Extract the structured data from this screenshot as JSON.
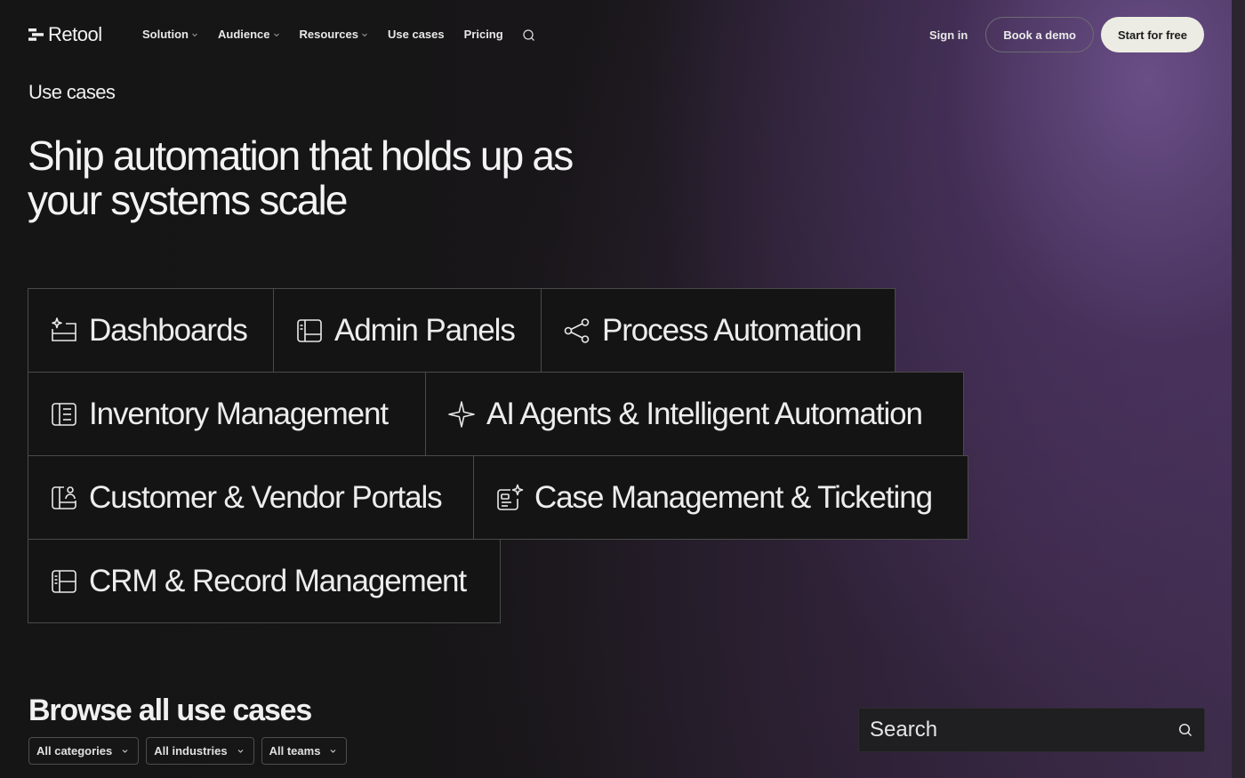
{
  "nav": {
    "logo_text": "Retool",
    "links": [
      {
        "label": "Solution",
        "dropdown": true
      },
      {
        "label": "Audience",
        "dropdown": true
      },
      {
        "label": "Resources",
        "dropdown": true
      },
      {
        "label": "Use cases",
        "dropdown": false
      },
      {
        "label": "Pricing",
        "dropdown": false
      }
    ],
    "sign_in": "Sign in",
    "book_demo": "Book a demo",
    "start_free": "Start for free"
  },
  "hero": {
    "eyebrow": "Use cases",
    "title": "Ship automation that holds up as your systems scale"
  },
  "categories": [
    {
      "label": "Dashboards",
      "icon": "dashboard-sparkle-icon"
    },
    {
      "label": "Admin Panels",
      "icon": "panel-layout-icon"
    },
    {
      "label": "Process Automation",
      "icon": "share-nodes-icon"
    },
    {
      "label": "Inventory Management",
      "icon": "list-panel-icon"
    },
    {
      "label": "AI Agents & Intelligent Automation",
      "icon": "sparkle-icon"
    },
    {
      "label": "Customer & Vendor Portals",
      "icon": "portal-user-icon"
    },
    {
      "label": "Case Management & Ticketing",
      "icon": "ticket-sparkle-icon"
    },
    {
      "label": "CRM & Record Management",
      "icon": "record-panel-icon"
    }
  ],
  "browse": {
    "title": "Browse all use cases",
    "filters": [
      "All categories",
      "All industries",
      "All teams"
    ],
    "search_placeholder": "Search"
  },
  "colors": {
    "background": "#151515",
    "accent_gradient": "#6c508a",
    "tile_border": "#4a4a4a",
    "cta_bg": "#ecece4"
  }
}
